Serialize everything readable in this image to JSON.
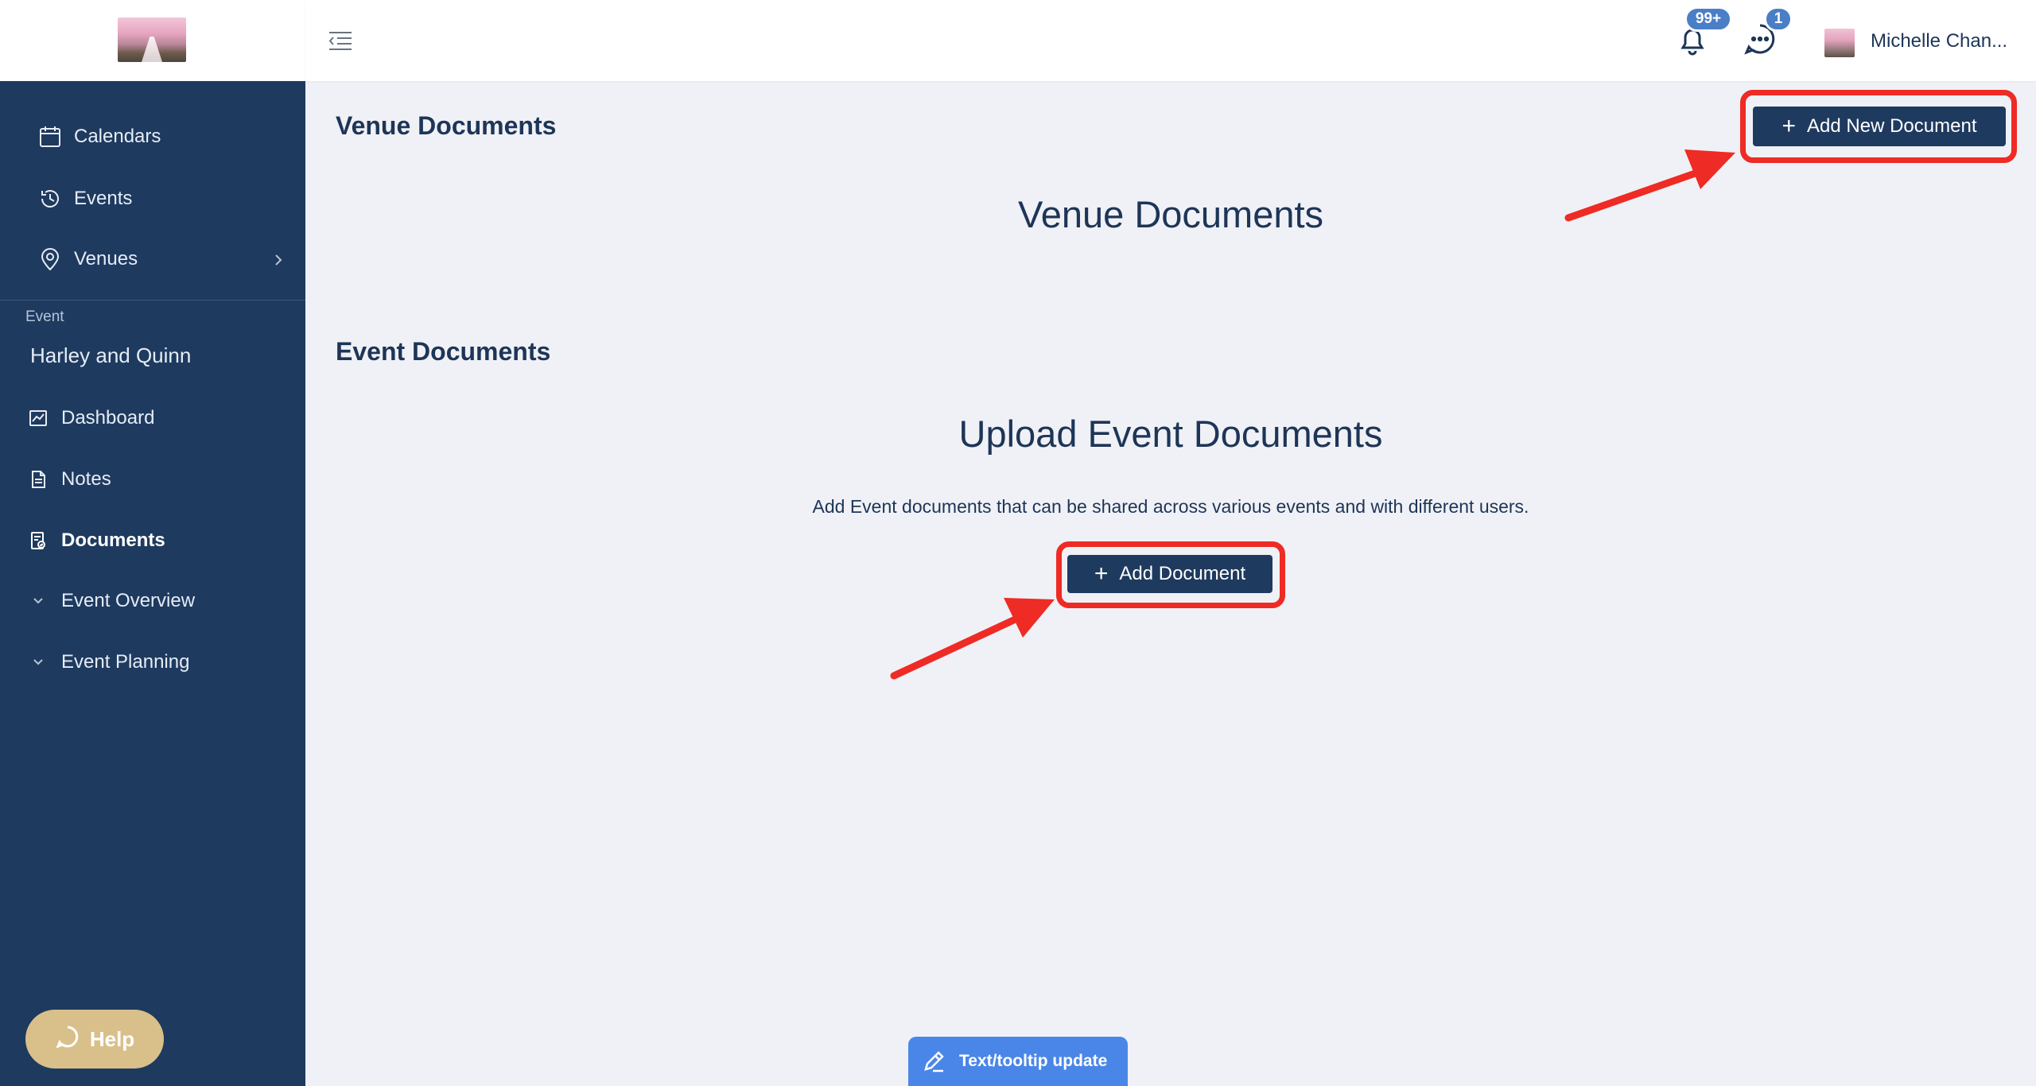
{
  "sidebar": {
    "top_items": [
      {
        "label": "Calendars",
        "icon": "calendar-icon"
      },
      {
        "label": "Events",
        "icon": "history-icon"
      },
      {
        "label": "Venues",
        "icon": "map-pin-icon"
      }
    ],
    "section_label": "Event",
    "event_name": "Harley and Quinn",
    "event_items": [
      {
        "label": "Dashboard",
        "icon": "chart-icon"
      },
      {
        "label": "Notes",
        "icon": "note-icon"
      },
      {
        "label": "Documents",
        "icon": "document-icon",
        "active": true
      },
      {
        "label": "Event Overview",
        "icon": "chevron-down-icon"
      },
      {
        "label": "Event Planning",
        "icon": "chevron-down-icon"
      }
    ],
    "help_label": "Help"
  },
  "header": {
    "notifications_badge": "99+",
    "messages_badge": "1",
    "user_name": "Michelle Chan..."
  },
  "main": {
    "venue_section_title": "Venue Documents",
    "add_new_document_label": "Add New Document",
    "venue_heading": "Venue Documents",
    "event_section_title": "Event Documents",
    "upload_heading": "Upload Event Documents",
    "upload_description": "Add Event documents that can be shared across various events and with different users.",
    "add_document_label": "Add Document"
  },
  "tooltip_bar": {
    "label": "Text/tooltip update"
  },
  "colors": {
    "sidebar_bg": "#1e3a5f",
    "content_bg": "#f0f1f6",
    "accent": "#1e3a5f",
    "badge": "#4a7ec7",
    "highlight": "#ee2b24",
    "help": "#d9c08a",
    "tooltip_bar": "#4a86e8"
  }
}
